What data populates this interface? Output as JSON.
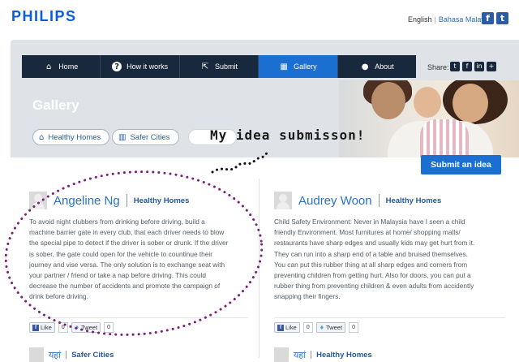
{
  "header": {
    "logo": "PHILIPS",
    "lang_english": "English",
    "lang_sep": "|",
    "lang_malay": "Bahasa Malaysia",
    "facebook_glyph": "f",
    "twitter_glyph": "t"
  },
  "nav": {
    "items": [
      {
        "label": "Home",
        "icon": "home-icon",
        "glyph": "⌂"
      },
      {
        "label": "How it works",
        "icon": "question-icon",
        "glyph": "?"
      },
      {
        "label": "Submit",
        "icon": "submit-icon",
        "glyph": "⇱"
      },
      {
        "label": "Gallery",
        "icon": "grid-icon",
        "glyph": "▦"
      },
      {
        "label": "About",
        "icon": "bulb-icon",
        "glyph": "●"
      }
    ],
    "share_label": "Share:",
    "share_icons": [
      {
        "name": "twitter-share-icon",
        "glyph": "t"
      },
      {
        "name": "facebook-share-icon",
        "glyph": "f"
      },
      {
        "name": "linkedin-share-icon",
        "glyph": "in"
      },
      {
        "name": "plus-share-icon",
        "glyph": "+"
      }
    ]
  },
  "page": {
    "title": "Gallery",
    "filters": [
      {
        "label": "Healthy Homes",
        "icon": "house-icon",
        "glyph": "⌂"
      },
      {
        "label": "Safer Cities",
        "icon": "city-icon",
        "glyph": "▥"
      }
    ],
    "annotation": "My idea submisson!",
    "submit_button": "Submit an idea"
  },
  "cards": [
    {
      "author": "Angeline Ng",
      "category": "Healthy Homes",
      "lines": [
        "To avoid night clubbers from drinking before driving, build a",
        "machine barrier gate in every club, that each driver needs to blow",
        "the special pipe to detect if the driver is sober or drunk. If the driver",
        "is sober, the gate could open for the vehicle to countinue their",
        "journey and vise versa. The only solution is to exchange seat with",
        "your partner / friend or take a nap before driving. This could",
        "decrease the number of accidents and promote the campaign of",
        "drink before driving."
      ],
      "like_label": "Like",
      "like_count": "0",
      "tweet_label": "Tweet",
      "tweet_count": "0"
    },
    {
      "author": "Audrey Woon",
      "category": "Healthy Homes",
      "lines": [
        "Child Safety Environment: Never in Malaysia have I seen a child",
        "friendly Environment. Most furnitures at home/ shopping malls/",
        "restaurants have sharp edges and usually kids may get hurt from it.",
        "They can run into a sharp end of a table and bruised themselves.",
        "You can put this rubber thing at all sharp edges and corners from",
        "preventing children from getting hurt. Also for doors, you can put a",
        "rubber thing from preventing children & even adults from accidently",
        "snapping their fingers."
      ],
      "like_label": "Like",
      "like_count": "0",
      "tweet_label": "Tweet",
      "tweet_count": "0"
    }
  ],
  "bottom": [
    {
      "author": "यहां",
      "category": "Safer Cities"
    },
    {
      "author": "यहां",
      "category": "Healthy Homes"
    }
  ],
  "colors": {
    "brand": "#0b5ed7",
    "nav_bg": "#18283d",
    "nav_active": "#1a6fd1",
    "annotation_dots": "#7a1f7a"
  }
}
